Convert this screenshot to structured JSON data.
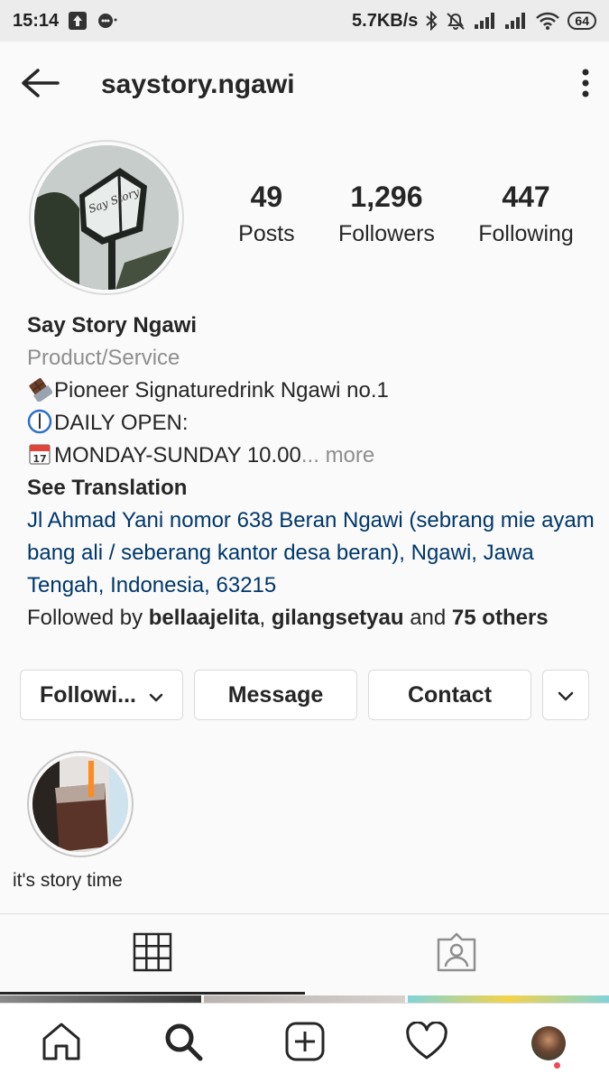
{
  "status_bar": {
    "time": "15:14",
    "speed": "5.7KB/s",
    "battery": "64"
  },
  "header": {
    "username": "saystory.ngawi"
  },
  "stats": [
    {
      "value": "49",
      "label": "Posts"
    },
    {
      "value": "1,296",
      "label": "Followers"
    },
    {
      "value": "447",
      "label": "Following"
    }
  ],
  "bio": {
    "name": "Say Story Ngawi",
    "category": "Product/Service",
    "line1": "Pioneer Signaturedrink Ngawi no.1",
    "line2": "DAILY OPEN:",
    "line3": "MONDAY-SUNDAY 10.00",
    "more": "... more",
    "see_translation": "See Translation",
    "address": "Jl Ahmad Yani nomor 638 Beran Ngawi (sebrang mie ayam bang ali / seberang kantor desa beran), Ngawi, Jawa Tengah, Indonesia, 63215",
    "followed_prefix": "Followed by ",
    "followed_user1": "bellaajelita",
    "followed_sep": ", ",
    "followed_user2": "gilangsetyau",
    "followed_and": " and ",
    "followed_others": "75 others"
  },
  "buttons": {
    "following": "Followi...",
    "message": "Message",
    "contact": "Contact"
  },
  "highlights": [
    {
      "label": "it's story time"
    }
  ],
  "colors": {
    "link": "#00376b",
    "muted": "#8e8e8e",
    "border": "#dbdbdb",
    "notification": "#ed4956"
  }
}
